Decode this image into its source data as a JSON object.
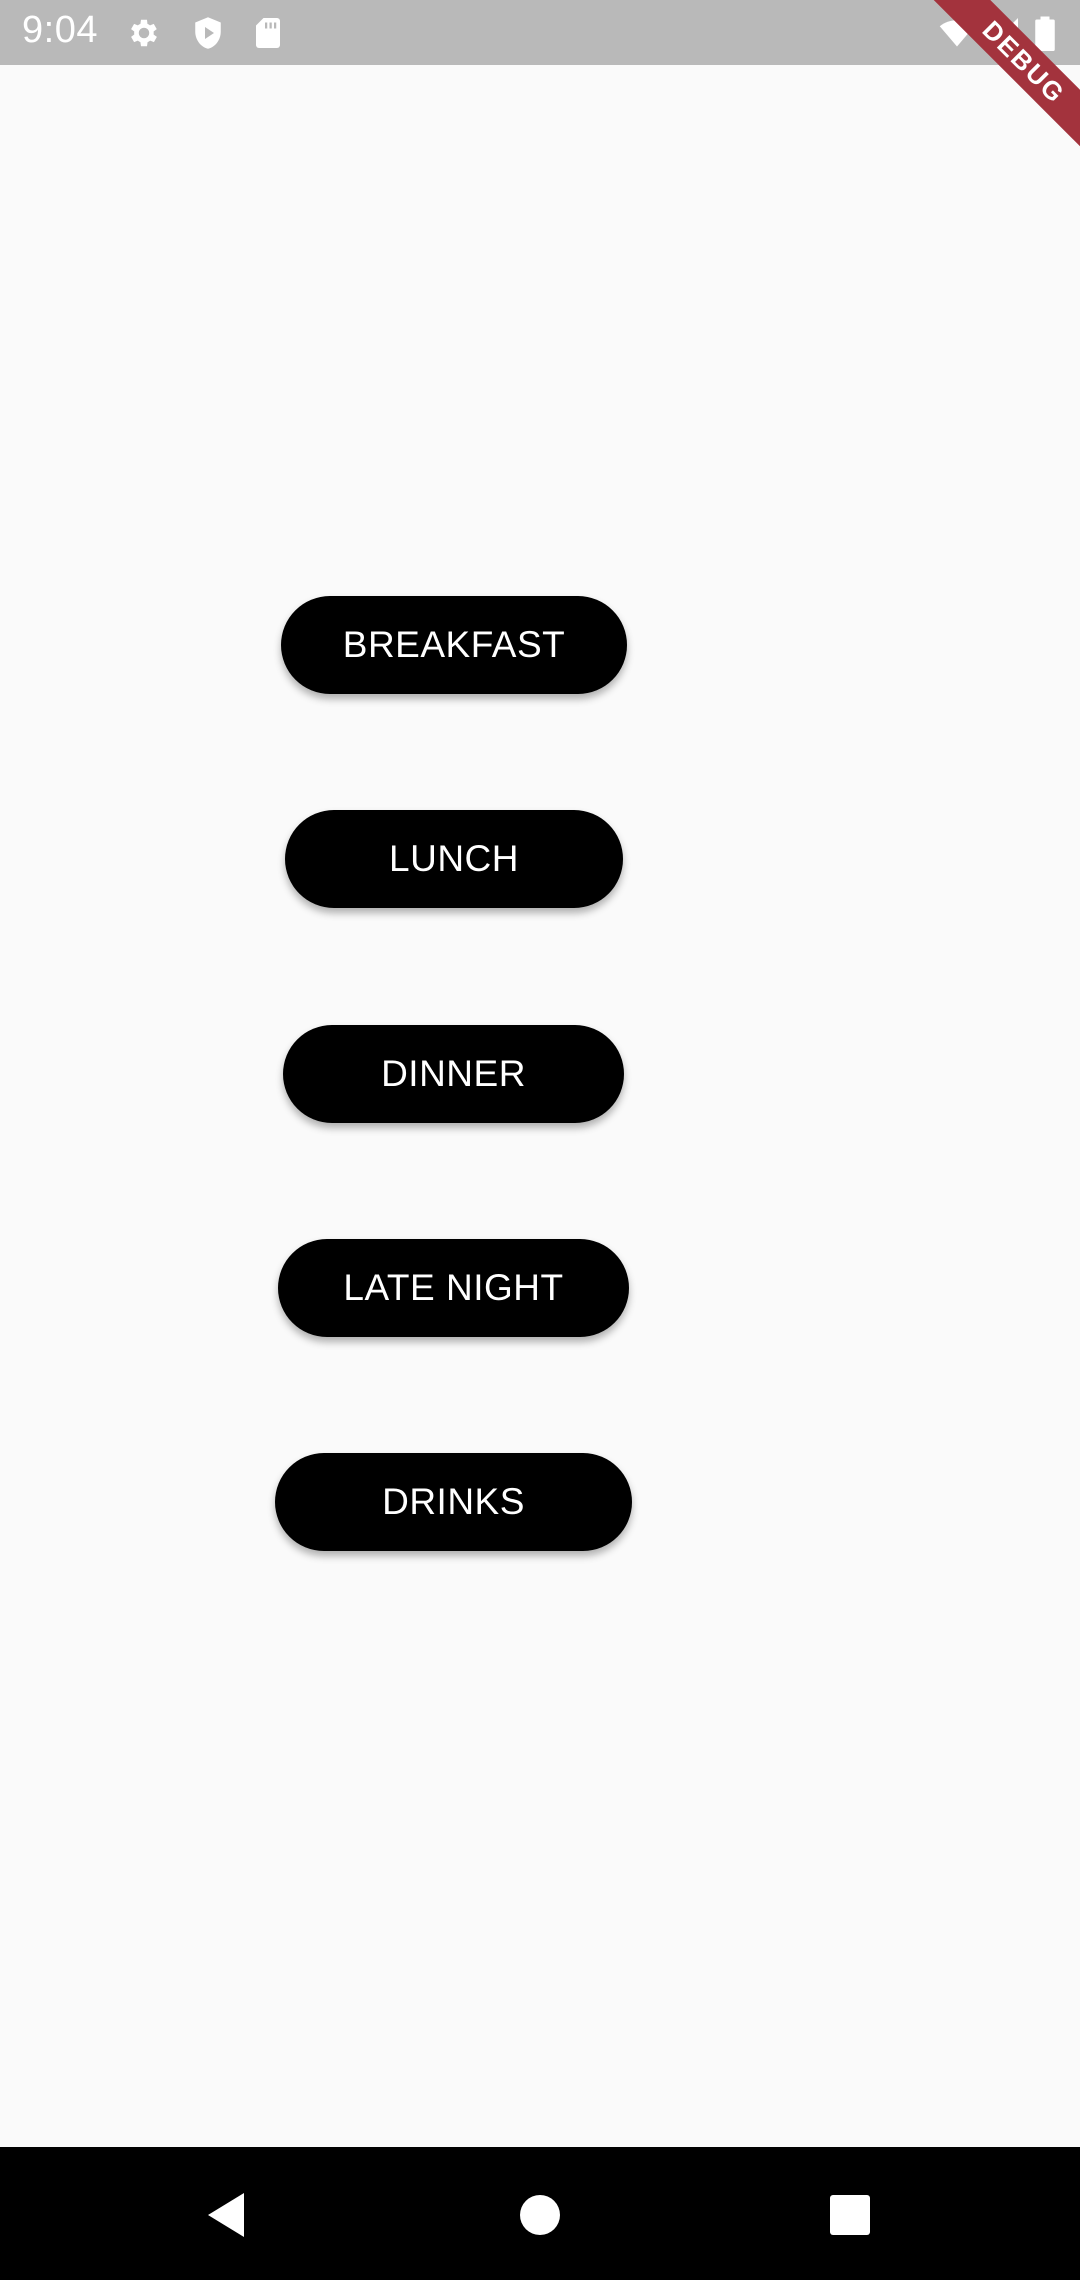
{
  "status_bar": {
    "time": "9:04",
    "icons": [
      "gear-icon",
      "shield-play-icon",
      "sd-card-icon",
      "wifi-icon",
      "signal-icon",
      "battery-icon"
    ],
    "debug_label": "DEBUG",
    "background": "#b9b9b9"
  },
  "main": {
    "buttons": [
      {
        "label": "BREAKFAST"
      },
      {
        "label": "LUNCH"
      },
      {
        "label": "DINNER"
      },
      {
        "label": "LATE NIGHT"
      },
      {
        "label": "DRINKS"
      }
    ],
    "button_color": "#000000",
    "text_color": "#ffffff",
    "background": "#fafafa"
  },
  "nav_bar": {
    "icons": [
      "back-icon",
      "home-icon",
      "recents-icon"
    ],
    "background": "#000000"
  }
}
